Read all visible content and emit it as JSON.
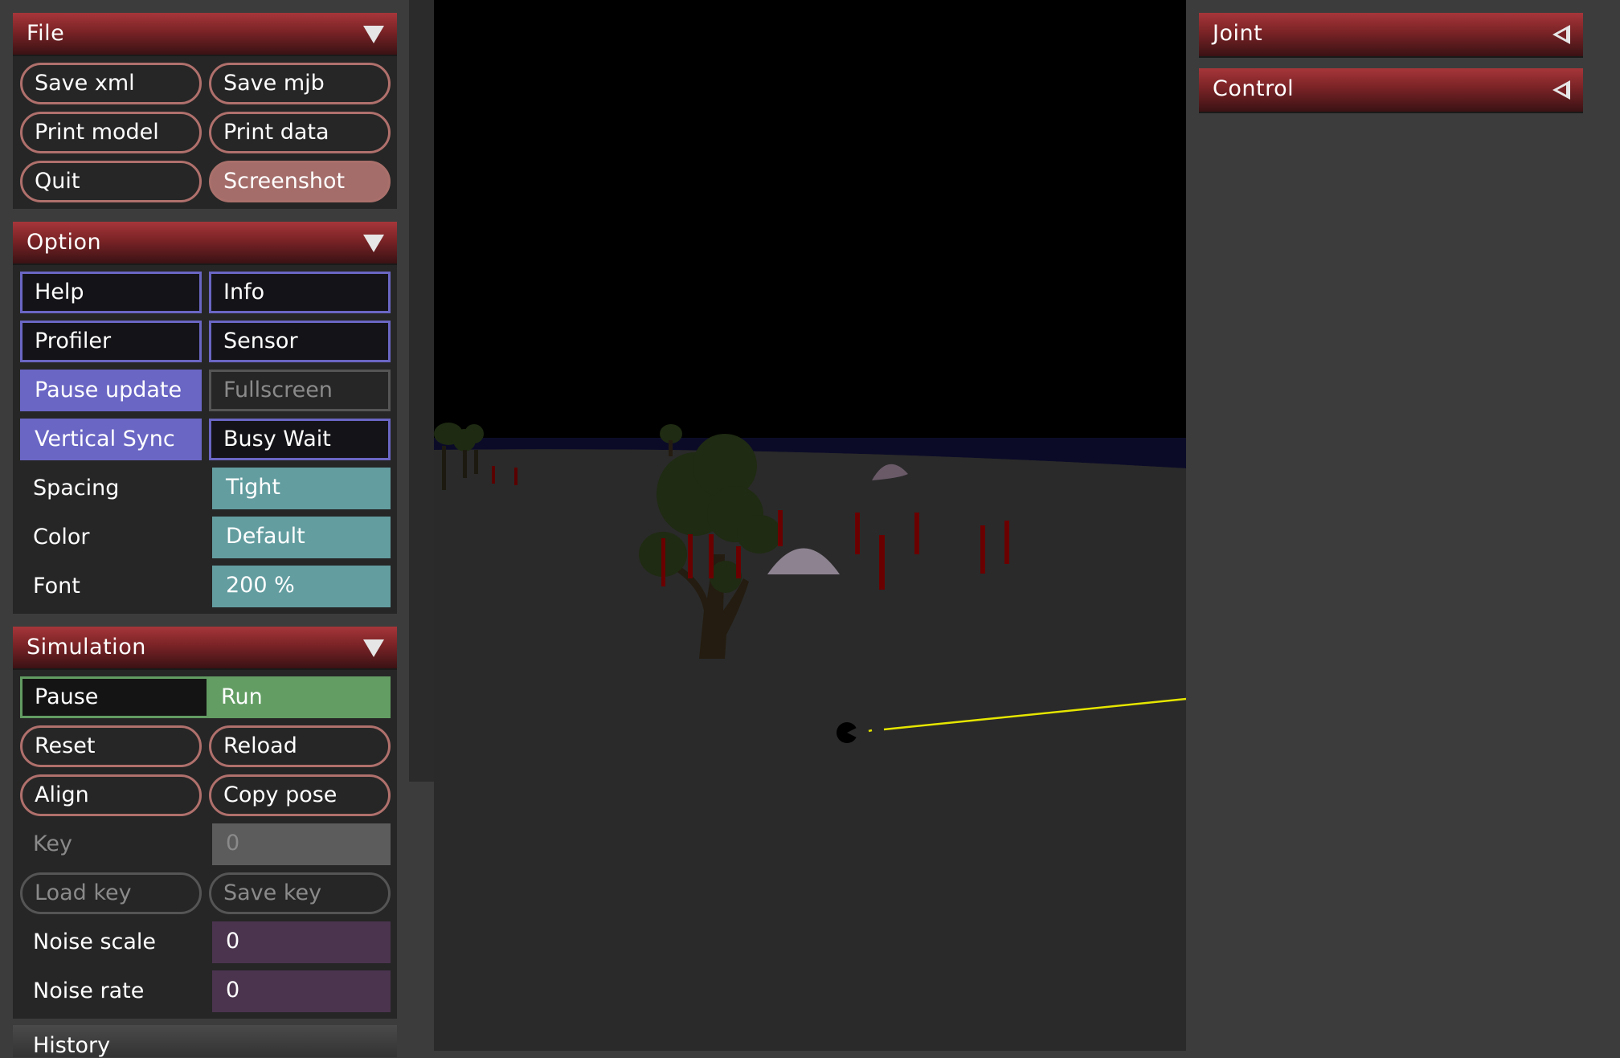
{
  "file": {
    "title": "File",
    "buttons": [
      "Save xml",
      "Save mjb",
      "Print model",
      "Print data",
      "Quit",
      "Screenshot"
    ]
  },
  "option": {
    "title": "Option",
    "buttons": [
      "Help",
      "Info",
      "Profiler",
      "Sensor",
      "Pause update",
      "Fullscreen",
      "Vertical Sync",
      "Busy Wait"
    ],
    "spacing_label": "Spacing",
    "spacing_value": "Tight",
    "color_label": "Color",
    "color_value": "Default",
    "font_label": "Font",
    "font_value": "200 %"
  },
  "simulation": {
    "title": "Simulation",
    "pause_label": "Pause",
    "run_label": "Run",
    "reset_label": "Reset",
    "reload_label": "Reload",
    "align_label": "Align",
    "copy_pose_label": "Copy pose",
    "key_label": "Key",
    "key_value": "0",
    "load_key_label": "Load key",
    "save_key_label": "Save key",
    "noise_scale_label": "Noise scale",
    "noise_scale_value": "0",
    "noise_rate_label": "Noise rate",
    "noise_rate_value": "0"
  },
  "history": {
    "title": "History"
  },
  "right_panel": {
    "joint_title": "Joint",
    "control_title": "Control"
  },
  "colors": {
    "header_red": "#a6363a",
    "button_red_border": "#b0706c",
    "button_blue": "#6a66c4",
    "teal": "#639da0",
    "green": "#639d63",
    "purple": "#4b344e"
  }
}
